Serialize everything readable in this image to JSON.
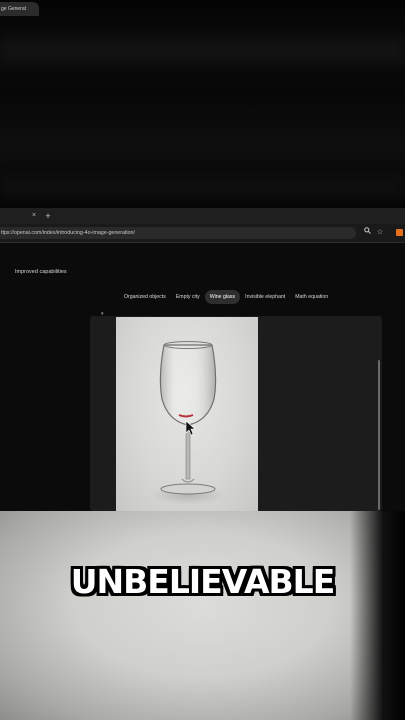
{
  "browser": {
    "tab_title": "ge Generat",
    "tab_close": "×",
    "new_tab": "+",
    "url": "ttps://openai.com/index/introducing-4o-image-generation/",
    "search_icon": "🔍",
    "star_icon": "☆"
  },
  "page": {
    "section_title": "Improved capabilities",
    "tabs": [
      {
        "label": "Organized objects",
        "active": false
      },
      {
        "label": "Empty city",
        "active": false
      },
      {
        "label": "Wine glass",
        "active": true
      },
      {
        "label": "Invisible elephant",
        "active": false
      },
      {
        "label": "Math equation",
        "active": false
      }
    ],
    "card_marker": "▾"
  },
  "overlay": {
    "caption": "UNBELIEVABLE"
  },
  "colors": {
    "background": "#000000",
    "accent_extension": "#e7711b",
    "active_pill": "#2e2e2e"
  }
}
